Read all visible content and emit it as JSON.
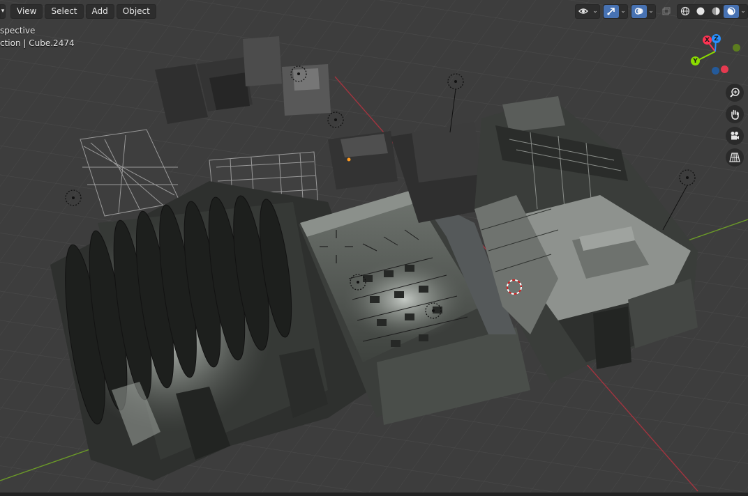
{
  "header": {
    "menus": [
      {
        "label": "View"
      },
      {
        "label": "Select"
      },
      {
        "label": "Add"
      },
      {
        "label": "Object"
      }
    ],
    "edge_glyph": "▾"
  },
  "overlay": {
    "view_name": "spective",
    "collection_info": "ction | Cube.2474"
  },
  "tools": {
    "visibility_icon": "eye-icon",
    "gizmo_icon": "gizmo-arrow-icon",
    "overlay_icon": "overlay-circles-icon",
    "xray_icon": "xray-icon",
    "shading_modes": [
      "wireframe-shading-icon",
      "solid-shading-icon",
      "material-shading-icon",
      "rendered-shading-icon"
    ],
    "active_shading": "rendered-shading-icon",
    "dropdown_glyph": "⌄"
  },
  "gizmo": {
    "x_label": "X",
    "y_label": "Y",
    "z_label": "Z",
    "x_color": "#ff3352",
    "y_color": "#8bdc00",
    "z_color": "#2890ff"
  },
  "nav_buttons": [
    "zoom-icon",
    "hand-pan-icon",
    "camera-icon",
    "grid-ortho-icon"
  ],
  "colors": {
    "background": "#3d3d3d",
    "grid": "#484848",
    "x_axis": "#a3343f",
    "y_axis": "#6b9a28",
    "accent": "#4772b3"
  }
}
